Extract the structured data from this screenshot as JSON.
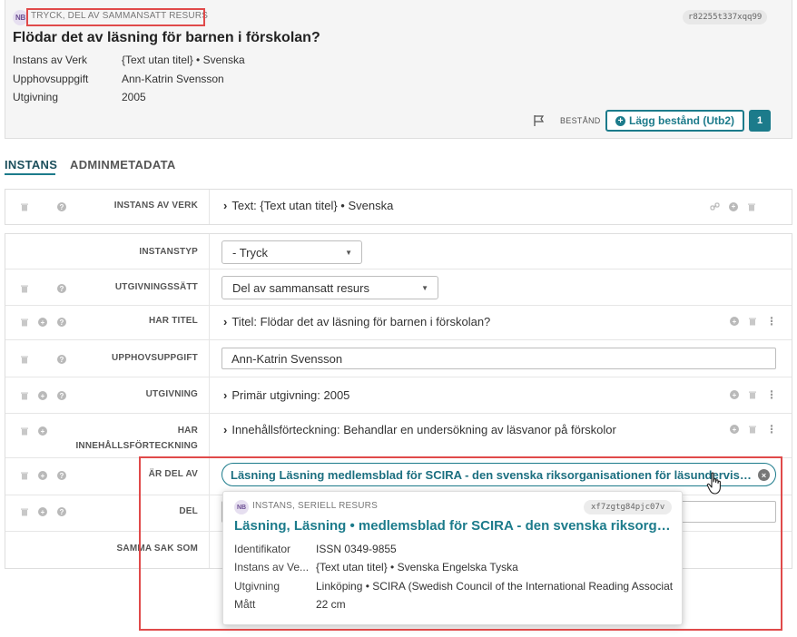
{
  "header": {
    "badge": "NB",
    "type_label": "TRYCK, DEL AV SAMMANSATT RESURS",
    "record_id": "r82255t337xqq99",
    "title": "Flödar det av läsning för barnen i förskolan?",
    "meta": [
      {
        "key": "Instans av Verk",
        "value": "{Text utan titel} • Svenska"
      },
      {
        "key": "Upphovsuppgift",
        "value": "Ann-Katrin Svensson"
      },
      {
        "key": "Utgivning",
        "value": "2005"
      }
    ],
    "bestand_label": "BESTÅND",
    "add_button_label": "Lägg bestånd (Utb2)",
    "holdings_count": "1"
  },
  "tabs": [
    {
      "label": "INSTANS",
      "active": true
    },
    {
      "label": "ADMINMETADATA",
      "active": false
    }
  ],
  "rows": {
    "instans_av_verk": {
      "label": "INSTANS AV VERK",
      "value": "Text: {Text utan titel} • Svenska"
    },
    "instanstyp": {
      "label": "INSTANSTYP",
      "value": "- Tryck"
    },
    "utgivningssatt": {
      "label": "UTGIVNINGSSÄTT",
      "value": "Del av sammansatt resurs"
    },
    "har_titel": {
      "label": "HAR TITEL",
      "value": "Titel: Flödar det av läsning för barnen i förskolan?"
    },
    "upphovsuppgift": {
      "label": "UPPHOVSUPPGIFT",
      "value": "Ann-Katrin Svensson"
    },
    "utgivning": {
      "label": "UTGIVNING",
      "value": "Primär utgivning: 2005"
    },
    "har_innehall": {
      "label_line1": "HAR",
      "label_line2": "INNEHÅLLSFÖRTECKNING",
      "value": "Innehållsförteckning: Behandlar en undersökning av läsvanor på förskolor"
    },
    "ar_del_av": {
      "label": "ÄR DEL AV",
      "value": "Läsning Läsning medlemsblad för SCIRA - den svenska riksorganisationen för läsundervisning"
    },
    "del": {
      "label": "DEL",
      "value": ""
    },
    "samma_sak_som": {
      "label": "SAMMA SAK SOM"
    }
  },
  "popover": {
    "badge": "NB",
    "type_label": "INSTANS, SERIELL RESURS",
    "record_id": "xf7zgtg84pjc07v",
    "title": "Läsning, Läsning • medlemsblad för SCIRA - den svenska riksorganisationen för läsundervisning",
    "fields": [
      {
        "key": "Identifikator",
        "value": "ISSN 0349-9855"
      },
      {
        "key": "Instans av Ve...",
        "value": "{Text utan titel} • Svenska Engelska Tyska"
      },
      {
        "key": "Utgivning",
        "value": "Linköping • SCIRA (Swedish Council of the International Reading Associat"
      },
      {
        "key": "Mått",
        "value": "22 cm"
      }
    ]
  },
  "colors": {
    "accent": "#1c7b8b",
    "highlight": "#e04a4a",
    "header_bg": "#f5f5f5"
  }
}
